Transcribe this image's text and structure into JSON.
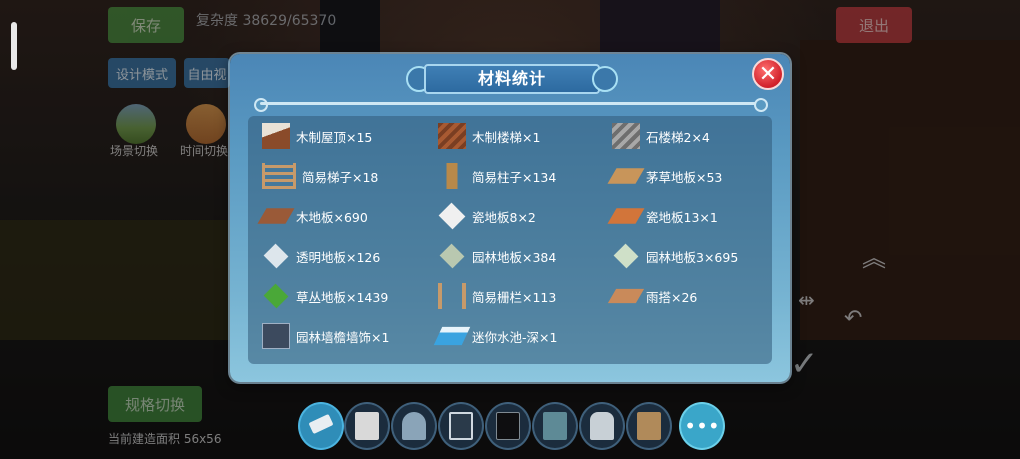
{
  "top": {
    "save_label": "保存",
    "complexity_text": "复杂度 38629/65370",
    "exit_label": "退出"
  },
  "left_panel": {
    "design_mode_label": "设计模式",
    "free_switch_label": "自由视",
    "scene_switch_label": "场景切换",
    "time_switch_label": "时间切换",
    "spec_switch_label": "规格切换",
    "build_area_text": "当前建造面积 56x56"
  },
  "dialog": {
    "title": "材料统计",
    "close_icon": "close-x-icon",
    "items": [
      {
        "label": "木制屋顶×15",
        "icon": "wood-roof-icon"
      },
      {
        "label": "木制楼梯×1",
        "icon": "wood-stairs-icon"
      },
      {
        "label": "石楼梯2×4",
        "icon": "stone-stairs-icon"
      },
      {
        "label": "简易梯子×18",
        "icon": "simple-ladder-icon"
      },
      {
        "label": "简易柱子×134",
        "icon": "simple-pillar-icon"
      },
      {
        "label": "茅草地板×53",
        "icon": "thatch-floor-icon"
      },
      {
        "label": "木地板×690",
        "icon": "wood-floor-icon"
      },
      {
        "label": "瓷地板8×2",
        "icon": "tile-floor-8-icon"
      },
      {
        "label": "瓷地板13×1",
        "icon": "tile-floor-13-icon"
      },
      {
        "label": "透明地板×126",
        "icon": "transparent-floor-icon"
      },
      {
        "label": "园林地板×384",
        "icon": "garden-floor-icon"
      },
      {
        "label": "园林地板3×695",
        "icon": "garden-floor-3-icon"
      },
      {
        "label": "草丛地板×1439",
        "icon": "grass-floor-icon"
      },
      {
        "label": "简易栅栏×113",
        "icon": "simple-fence-icon"
      },
      {
        "label": "雨搭×26",
        "icon": "awning-icon"
      },
      {
        "label": "园林墙檐墙饰×1",
        "icon": "garden-wall-eave-icon"
      },
      {
        "label": "迷你水池-深×1",
        "icon": "mini-pool-deep-icon"
      }
    ]
  },
  "toolbar": {
    "tools": [
      "eraser-icon",
      "wall-panel-icon",
      "arch-gate-icon",
      "window-frame-icon",
      "dark-panel-icon",
      "cabinet-icon",
      "door-icon",
      "wardrobe-icon",
      "more-icon"
    ],
    "more_label": "•••"
  },
  "colors": {
    "dialog_top": "#4b86b6",
    "dialog_bottom": "#8cc6de",
    "close_red": "#d0202a",
    "save_green": "#3f8a3a",
    "exit_red": "#b8343a"
  }
}
